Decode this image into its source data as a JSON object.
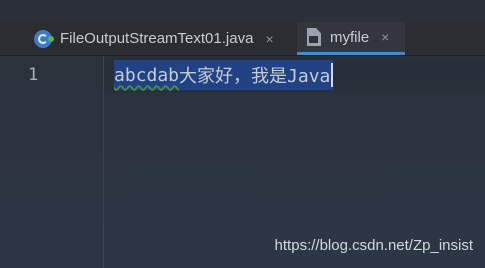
{
  "tabs": [
    {
      "label": "FileOutputStreamText01.java",
      "icon": "java-class-icon",
      "close": "×",
      "active": false
    },
    {
      "label": "myfile",
      "icon": "text-file-icon",
      "close": "×",
      "active": true
    }
  ],
  "editor": {
    "line_numbers": [
      "1"
    ],
    "line_ascii": "abcdab",
    "line_rest": "大家好，我是Java"
  },
  "watermark": "https://blog.csdn.net/Zp_insist",
  "colors": {
    "selection": "#214283",
    "active_tab_underline": "#4a88c7",
    "background": "#2c3440"
  }
}
